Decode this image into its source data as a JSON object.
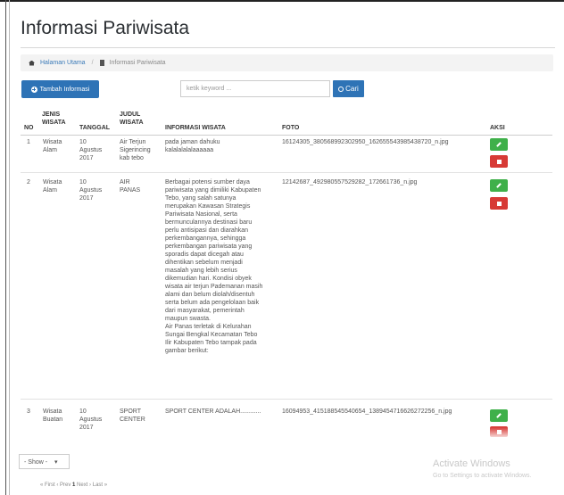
{
  "page": {
    "title": "Informasi Pariwisata"
  },
  "breadcrumb": {
    "home": "Halaman Utama",
    "current": "Informasi Pariwisata"
  },
  "toolbar": {
    "add_label": "Tambah Informasi",
    "search_placeholder": "ketik keyword ...",
    "search_label": "Cari"
  },
  "table": {
    "headers": {
      "no": "NO",
      "jenis": [
        "JENIS",
        "WISATA"
      ],
      "tanggal": "TANGGAL",
      "judul": [
        "JUDUL",
        "WISATA"
      ],
      "informasi": "INFORMASI WISATA",
      "foto": "FOTO",
      "aksi": "AKSI"
    },
    "rows": [
      {
        "no": "1",
        "jenis": [
          "Wisata",
          "Alam"
        ],
        "tanggal": [
          "10",
          "Agustus",
          "2017"
        ],
        "judul": [
          "Air Terjun",
          "Sigerincing",
          "kab tebo"
        ],
        "informasi": [
          "pada jaman dahuku",
          "kalalalalalaaaaaa"
        ],
        "foto": "16124305_380568992302950_162655543985438720_n.jpg"
      },
      {
        "no": "2",
        "jenis": [
          "Wisata",
          "Alam"
        ],
        "tanggal": [
          "10",
          "Agustus",
          "2017"
        ],
        "judul": [
          "AIR",
          "PANAS"
        ],
        "informasi": [
          "Berbagai potensi sumber daya",
          "pariwisata yang dimiliki Kabupaten",
          "Tebo, yang salah satunya",
          "merupakan Kawasan Strategis",
          "Pariwisata Nasional, serta",
          "bermunculannya destinasi baru",
          "perlu antisipasi dan diarahkan",
          "perkembangannya, sehingga",
          "perkembangan pariwisata yang",
          "sporadis dapat dicegah atau",
          "dihentikan sebelum menjadi",
          "masalah yang lebih serius",
          "dikemudian hari. Kondisi obyek",
          "wisata air terjun Pademanan masih",
          "alami dan belum diolah/disentuh",
          "serta belum ada pengelolaan baik",
          "dari masyarakat, pemerintah",
          "maupun swasta.",
          "Air Panas terletak di  Kelurahan",
          "Sungai Bengkal Kecamatan Tebo",
          "Ilir Kabupaten Tebo  tampak pada",
          "gambar berikut:"
        ],
        "foto": "12142687_492980557529282_172661736_n.jpg"
      },
      {
        "no": "3",
        "jenis": [
          "Wisata",
          "Buatan"
        ],
        "tanggal": [
          "10",
          "Agustus",
          "2017"
        ],
        "judul": [
          "SPORT",
          "CENTER"
        ],
        "informasi": [
          "SPORT CENTER ADALAH............"
        ],
        "foto": "16094953_415188545540654_1389454716626272256_n.jpg"
      }
    ]
  },
  "footer": {
    "show_label": "- Show -",
    "pager": {
      "first": "« First",
      "prev": "‹ Prev",
      "current": "1",
      "next": "Next ›",
      "last": "Last »"
    }
  },
  "overlay": {
    "activate_title": "Activate Windows",
    "activate_sub": "Go to Settings to activate Windows."
  },
  "colors": {
    "primary": "#2e73b6",
    "edit": "#3fb04a",
    "delete": "#d73a36"
  }
}
